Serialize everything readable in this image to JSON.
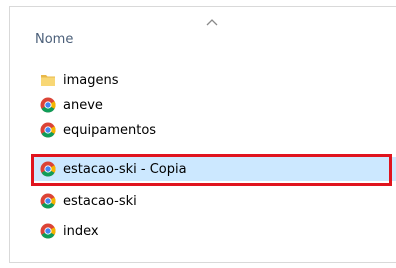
{
  "header": {
    "name_column": "Nome",
    "sort_indicator": "chevron-up-icon"
  },
  "files": [
    {
      "label": "imagens",
      "icon": "folder-icon",
      "selected": false
    },
    {
      "label": "aneve",
      "icon": "chrome-icon",
      "selected": false
    },
    {
      "label": "equipamentos",
      "icon": "chrome-icon",
      "selected": false
    },
    {
      "label": "estacao-ski - Copia",
      "icon": "chrome-icon",
      "selected": true
    },
    {
      "label": "estacao-ski",
      "icon": "chrome-icon",
      "selected": false
    },
    {
      "label": "index",
      "icon": "chrome-icon",
      "selected": false
    }
  ],
  "colors": {
    "selection_bg": "#cce8ff",
    "highlight_border": "#e0141e",
    "header_text": "#4c607a"
  }
}
